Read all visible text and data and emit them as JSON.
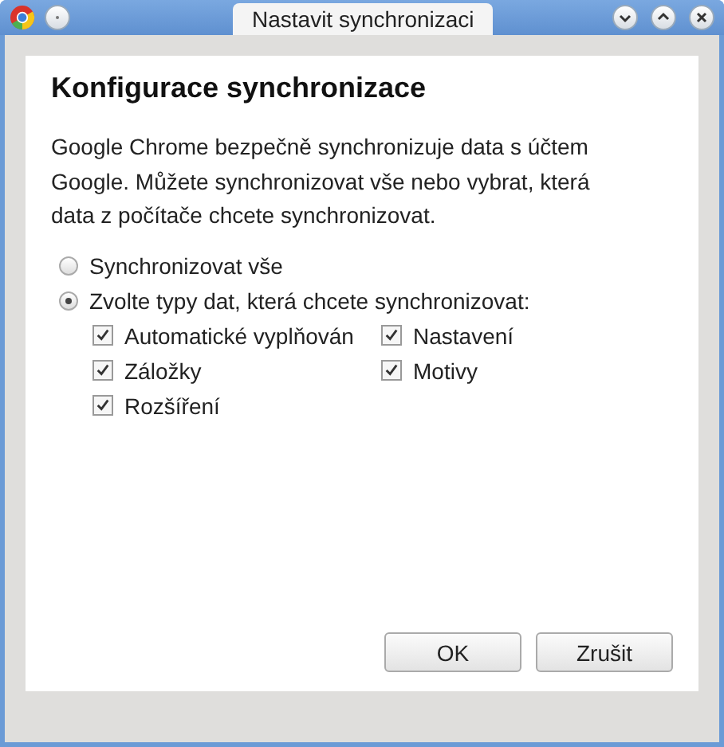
{
  "window": {
    "title": "Nastavit synchronizaci"
  },
  "heading": "Konfigurace synchronizace",
  "description": "Google Chrome bezpečně synchronizuje data s účtem Google. Můžete synchronizovat vše nebo vybrat, která data z počítače chcete synchronizovat.",
  "sync_options": [
    {
      "label": "Synchronizovat vše",
      "selected": false
    },
    {
      "label": "Zvolte typy dat, která chcete synchronizovat:",
      "selected": true
    }
  ],
  "data_types": [
    {
      "label": "Automatické vyplňován",
      "checked": true
    },
    {
      "label": "Nastavení",
      "checked": true
    },
    {
      "label": "Záložky",
      "checked": true
    },
    {
      "label": "Motivy",
      "checked": true
    },
    {
      "label": "Rozšíření",
      "checked": true
    }
  ],
  "buttons": [
    "OK",
    "Zrušit"
  ]
}
